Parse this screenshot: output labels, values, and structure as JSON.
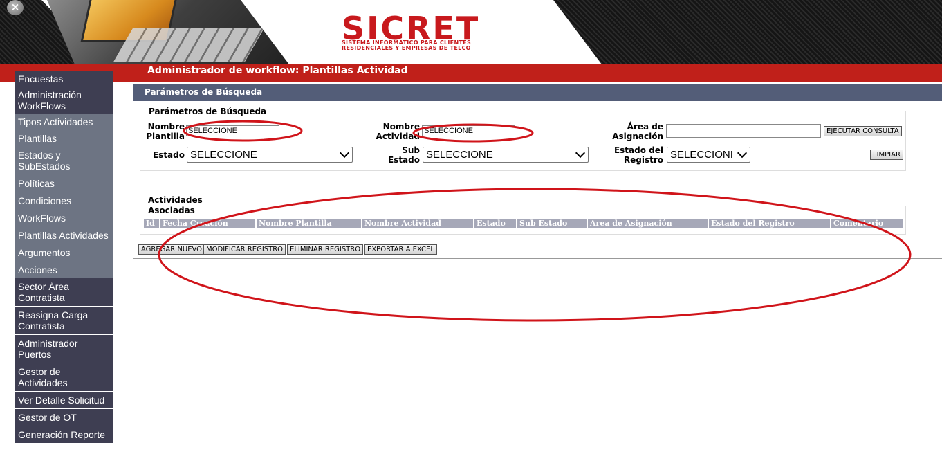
{
  "header": {
    "close_icon": "×",
    "logo_title": "SICRET",
    "logo_subtitle_line1": "SISTEMA INFORMATICO PARA CLIENTES",
    "logo_subtitle_line2": "RESIDENCIALES Y EMPRESAS DE TELCO"
  },
  "page": {
    "title": "Administrador de workflow: Plantillas Actividad"
  },
  "sidebar": {
    "items": [
      {
        "label": "Encuestas",
        "style": "dark"
      },
      {
        "label": "Administración WorkFlows",
        "style": "dark"
      },
      {
        "label": "Tipos Actividades",
        "style": "light"
      },
      {
        "label": "Plantillas",
        "style": "light"
      },
      {
        "label": "Estados y SubEstados",
        "style": "light"
      },
      {
        "label": "Políticas",
        "style": "light"
      },
      {
        "label": "Condiciones",
        "style": "light"
      },
      {
        "label": "WorkFlows",
        "style": "light"
      },
      {
        "label": "Plantillas Actividades",
        "style": "light"
      },
      {
        "label": "Argumentos",
        "style": "light"
      },
      {
        "label": "Acciones",
        "style": "light"
      },
      {
        "label": "Sector Área Contratista",
        "style": "dark"
      },
      {
        "label": "Reasigna Carga Contratista",
        "style": "dark"
      },
      {
        "label": "Administrador Puertos",
        "style": "dark"
      },
      {
        "label": "Gestor de Actividades",
        "style": "dark"
      },
      {
        "label": "Ver Detalle Solicitud",
        "style": "dark"
      },
      {
        "label": "Gestor de OT",
        "style": "dark"
      },
      {
        "label": "Generación Reporte",
        "style": "dark"
      }
    ]
  },
  "search": {
    "section_title": "Parámetros de Búsqueda",
    "legend": "Parámetros de Búsqueda",
    "nombre_plantilla_label": "Nombre Plantilla",
    "nombre_plantilla_value": "SELECCIONE",
    "nombre_actividad_label": "Nombre Actividad",
    "nombre_actividad_value": "SELECCIONE",
    "area_asignacion_label": "Área de Asignación",
    "area_asignacion_value": "",
    "estado_label": "Estado",
    "estado_value": "SELECCIONE",
    "sub_estado_label": "Sub Estado",
    "sub_estado_value": "SELECCIONE",
    "estado_registro_label": "Estado del Registro",
    "estado_registro_value": "SELECCIONI",
    "ejecutar_label": "EJECUTAR CONSULTA",
    "limpiar_label": "LIMPIAR"
  },
  "results": {
    "legend": "Actividades Asociadas",
    "columns": [
      "Id",
      "Fecha Creación",
      "Nombre Plantilla",
      "Nombre Actividad",
      "Estado",
      "Sub Estado",
      "Área de Asignación",
      "Estado del Registro",
      "Comentario"
    ],
    "rows": []
  },
  "actions": {
    "agregar": "AGREGAR NUEVO",
    "modificar": "MODIFICAR REGISTRO",
    "eliminar": "ELIMINAR REGISTRO",
    "exportar": "EXPORTAR A EXCEL"
  },
  "colors": {
    "brand_red": "#c0201a",
    "sidebar_dark": "#3e3e52",
    "sidebar_light": "#6d7483",
    "section_header": "#535d78",
    "table_header": "#a6a8b8",
    "annotation_red": "#d0141a"
  }
}
